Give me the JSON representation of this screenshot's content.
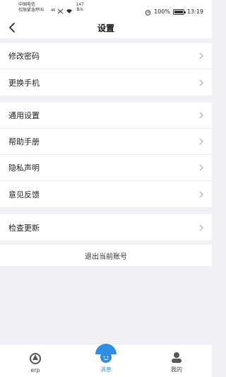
{
  "status_bar": {
    "carrier_line1": "中国电信",
    "carrier_line2": "仅限紧急呼叫",
    "network": "46",
    "speed_value": "147",
    "speed_unit": "B/s",
    "battery": "100%",
    "time": "13:19",
    "battery_level": 1.0
  },
  "header": {
    "title": "设置"
  },
  "groups": [
    {
      "items": [
        {
          "label": "修改密码"
        },
        {
          "label": "更换手机"
        }
      ]
    },
    {
      "items": [
        {
          "label": "通用设置"
        },
        {
          "label": "帮助手册"
        },
        {
          "label": "隐私声明"
        },
        {
          "label": "意见反馈"
        }
      ]
    },
    {
      "items": [
        {
          "label": "检查更新"
        }
      ]
    }
  ],
  "logout": {
    "label": "退出当前账号"
  },
  "tabbar": {
    "tabs": [
      {
        "label": "erp",
        "icon": "erp-icon"
      },
      {
        "label": "消息",
        "icon": "message-icon",
        "active": true
      },
      {
        "label": "我的",
        "icon": "profile-icon"
      }
    ]
  },
  "colors": {
    "accent": "#2f8de4",
    "background": "#f1f1f5"
  }
}
